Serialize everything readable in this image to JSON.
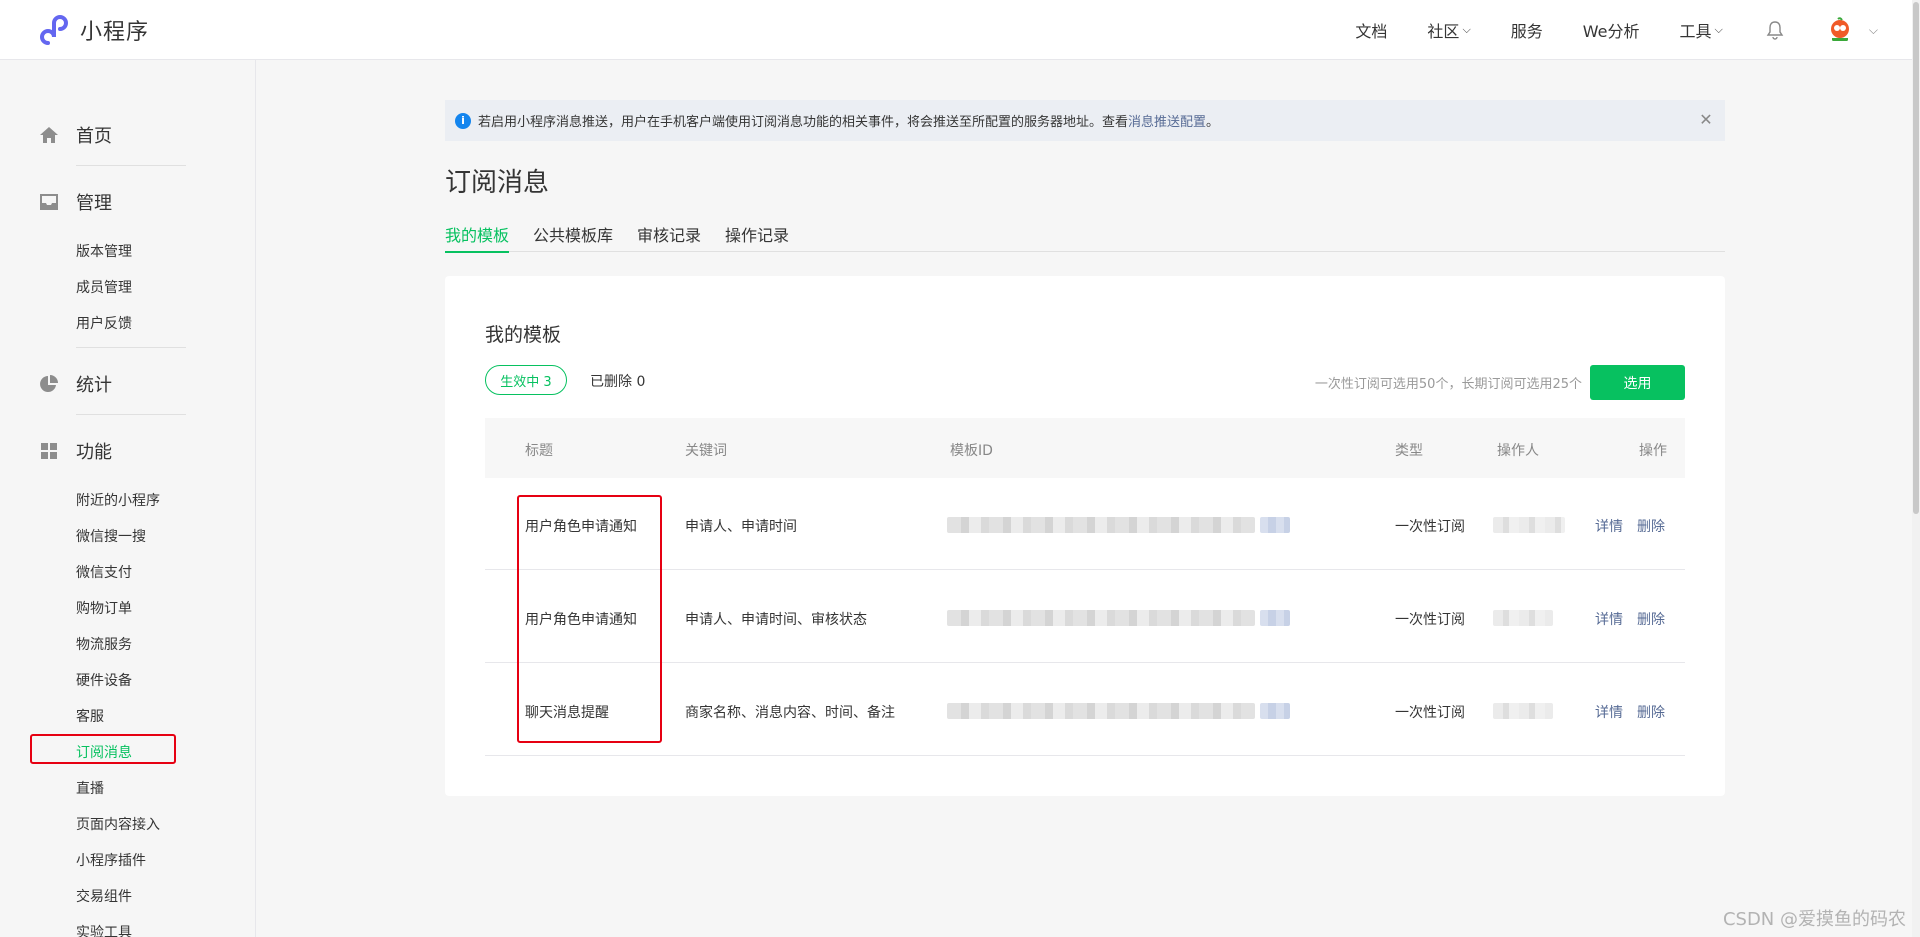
{
  "brand": {
    "name": "小程序"
  },
  "topnav": {
    "items": [
      {
        "label": "文档",
        "dropdown": false
      },
      {
        "label": "社区",
        "dropdown": true
      },
      {
        "label": "服务",
        "dropdown": false
      },
      {
        "label": "We分析",
        "dropdown": false
      },
      {
        "label": "工具",
        "dropdown": true
      }
    ]
  },
  "sidebar": {
    "groups": {
      "home": "首页",
      "manage": "管理",
      "stats": "统计",
      "features": "功能"
    },
    "manage_items": [
      "版本管理",
      "成员管理",
      "用户反馈"
    ],
    "feature_items": [
      "附近的小程序",
      "微信搜一搜",
      "微信支付",
      "购物订单",
      "物流服务",
      "硬件设备",
      "客服",
      "订阅消息",
      "直播",
      "页面内容接入",
      "小程序插件",
      "交易组件",
      "实验工具"
    ],
    "active_item": "订阅消息"
  },
  "notice": {
    "text": "若启用小程序消息推送，用户在手机客户端使用订阅消息功能的相关事件，将会推送至所配置的服务器地址。查看",
    "link": "消息推送配置",
    "end": "。"
  },
  "page": {
    "title": "订阅消息",
    "tabs": [
      "我的模板",
      "公共模板库",
      "审核记录",
      "操作记录"
    ]
  },
  "card": {
    "title": "我的模板",
    "filter_active": "生效中  3",
    "filter_deleted": "已删除  0",
    "quota": "一次性订阅可选用50个，长期订阅可选用25个",
    "select_button": "选用"
  },
  "table": {
    "headers": [
      "标题",
      "关键词",
      "模板ID",
      "类型",
      "操作人",
      "操作"
    ],
    "rows": [
      {
        "title": "用户角色申请通知",
        "keywords": "申请人、申请时间",
        "type": "一次性订阅",
        "detail": "详情",
        "delete": "删除"
      },
      {
        "title": "用户角色申请通知",
        "keywords": "申请人、申请时间、审核状态",
        "type": "一次性订阅",
        "detail": "详情",
        "delete": "删除"
      },
      {
        "title": "聊天消息提醒",
        "keywords": "商家名称、消息内容、时间、备注",
        "type": "一次性订阅",
        "detail": "详情",
        "delete": "删除"
      }
    ]
  },
  "watermark": "CSDN @爱摸鱼的码农",
  "colors": {
    "accent": "#07c160",
    "link": "#576b95",
    "highlight": "#e60012"
  }
}
